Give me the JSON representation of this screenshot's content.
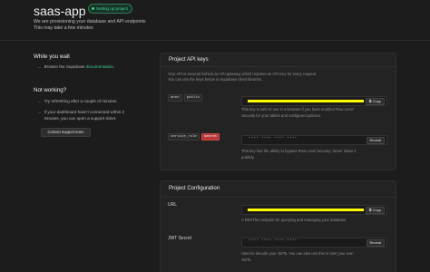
{
  "header": {
    "title": "saas-app",
    "badge": "Setting up project",
    "subtitle_line1": "We are provisioning your database and API endpoints",
    "subtitle_line2": "This may take a few minutes"
  },
  "while_you_wait": {
    "heading": "While you wait",
    "browse_prefix": "Browse the Supabase",
    "browse_link": "documentation",
    "browse_suffix": "."
  },
  "not_working": {
    "heading": "Not working?",
    "item1": "Try refreshing after a couple of minutes.",
    "item2_line1": "If your dashboard hasn't connected within 2",
    "item2_line2": "minutes, you can open a support ticket.",
    "support_button": "Contact support team"
  },
  "api_keys": {
    "heading": "Project API keys",
    "desc_line1": "Your API is secured behind an API gateway which requires an API Key for every request.",
    "desc_line2": "You can use the keys below in Supabase client libraries.",
    "anon": {
      "tag1": "anon",
      "tag2": "public",
      "copy_label": "Copy",
      "note_line1": "This key is safe to use in a browser if you have enabled Row Level",
      "note_line2": "Security for your tables and configured policies."
    },
    "service": {
      "tag1": "service_role",
      "tag2": "secret",
      "masked": "**** **** **** ****",
      "reveal_label": "Reveal",
      "note_line1": "This key has the ability to bypass Row Level Security. Never share it",
      "note_line2": "publicly."
    }
  },
  "config": {
    "heading": "Project Configuration",
    "url": {
      "label": "URL",
      "copy_label": "Copy",
      "note": "A RESTful endpoint for querying and managing your database."
    },
    "jwt": {
      "label": "JWT Secret",
      "masked": "**** **** **** ****",
      "reveal_label": "Reveal",
      "note_line1": "Used to decode your JWTs. You can also use this to mint your own",
      "note_line2": "JWTs."
    }
  },
  "colors": {
    "accent": "#3ecf8e",
    "danger": "#b83838",
    "redacted": "#ffff00"
  }
}
